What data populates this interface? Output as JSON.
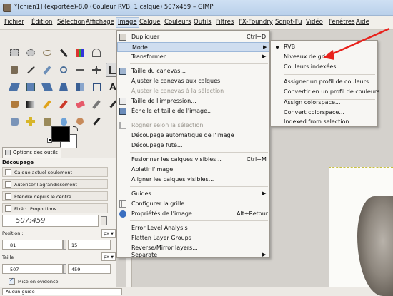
{
  "window": {
    "title": "*[chien1] (exportée)-8.0 (Couleur RVB, 1 calque) 507x459 – GIMP"
  },
  "menubar": [
    "Fichier",
    "Édition",
    "Sélection",
    "Affichage",
    "Image",
    "Calque",
    "Couleurs",
    "Outils",
    "Filtres",
    "FX-Foundry",
    "Script-Fu",
    "Vidéo",
    "Fenêtres",
    "Aide"
  ],
  "image_menu": {
    "items": [
      {
        "label": "Dupliquer",
        "shortcut": "Ctrl+D"
      },
      {
        "label": "Mode"
      },
      {
        "label": "Transformer"
      },
      {
        "label": "Taille du canevas..."
      },
      {
        "label": "Ajuster le canevas aux calques"
      },
      {
        "label": "Ajuster le canevas à la sélection"
      },
      {
        "label": "Taille de l'impression..."
      },
      {
        "label": "Échelle et taille de l'image..."
      },
      {
        "label": "Rogner selon la sélection"
      },
      {
        "label": "Découpage automatique de l'image"
      },
      {
        "label": "Découpage futé..."
      },
      {
        "label": "Fusionner les calques visibles...",
        "shortcut": "Ctrl+M"
      },
      {
        "label": "Aplatir l'image"
      },
      {
        "label": "Aligner les calques visibles..."
      },
      {
        "label": "Guides"
      },
      {
        "label": "Configurer la grille..."
      },
      {
        "label": "Propriétés de l'image",
        "shortcut": "Alt+Retour"
      },
      {
        "label": "Error Level Analysis"
      },
      {
        "label": "Flatten Layer Groups"
      },
      {
        "label": "Reverse/Mirror layers..."
      },
      {
        "label": "Separate"
      }
    ]
  },
  "mode_submenu": {
    "items": [
      {
        "label": "RVB"
      },
      {
        "label": "Niveaux de gris"
      },
      {
        "label": "Couleurs indexées"
      },
      {
        "label": "Assigner un profil de couleurs..."
      },
      {
        "label": "Convertir en un profil de couleurs..."
      },
      {
        "label": "Assign colorspace..."
      },
      {
        "label": "Convert colorspace..."
      },
      {
        "label": "Indexed from selection..."
      }
    ]
  },
  "tool_options": {
    "tab_label": "Options des outils",
    "section": "Découpage",
    "opt_layer": "Calque actuel seulement",
    "opt_grow": "Autoriser l'agrandissement",
    "opt_center": "Étendre depuis le centre",
    "fixed_label": "Fixé :",
    "fixed_value": "Proportions",
    "ratio": "507:459",
    "position_label": "Position :",
    "unit": "px",
    "pos_x": "81",
    "pos_y": "15",
    "size_label": "Taille :",
    "size_w": "507",
    "size_h": "459",
    "highlight": "Mise en évidence",
    "guides_value": "Aucun guide"
  },
  "colors": {
    "accent": "#e8221c",
    "menu_hl": "#cfddef"
  }
}
